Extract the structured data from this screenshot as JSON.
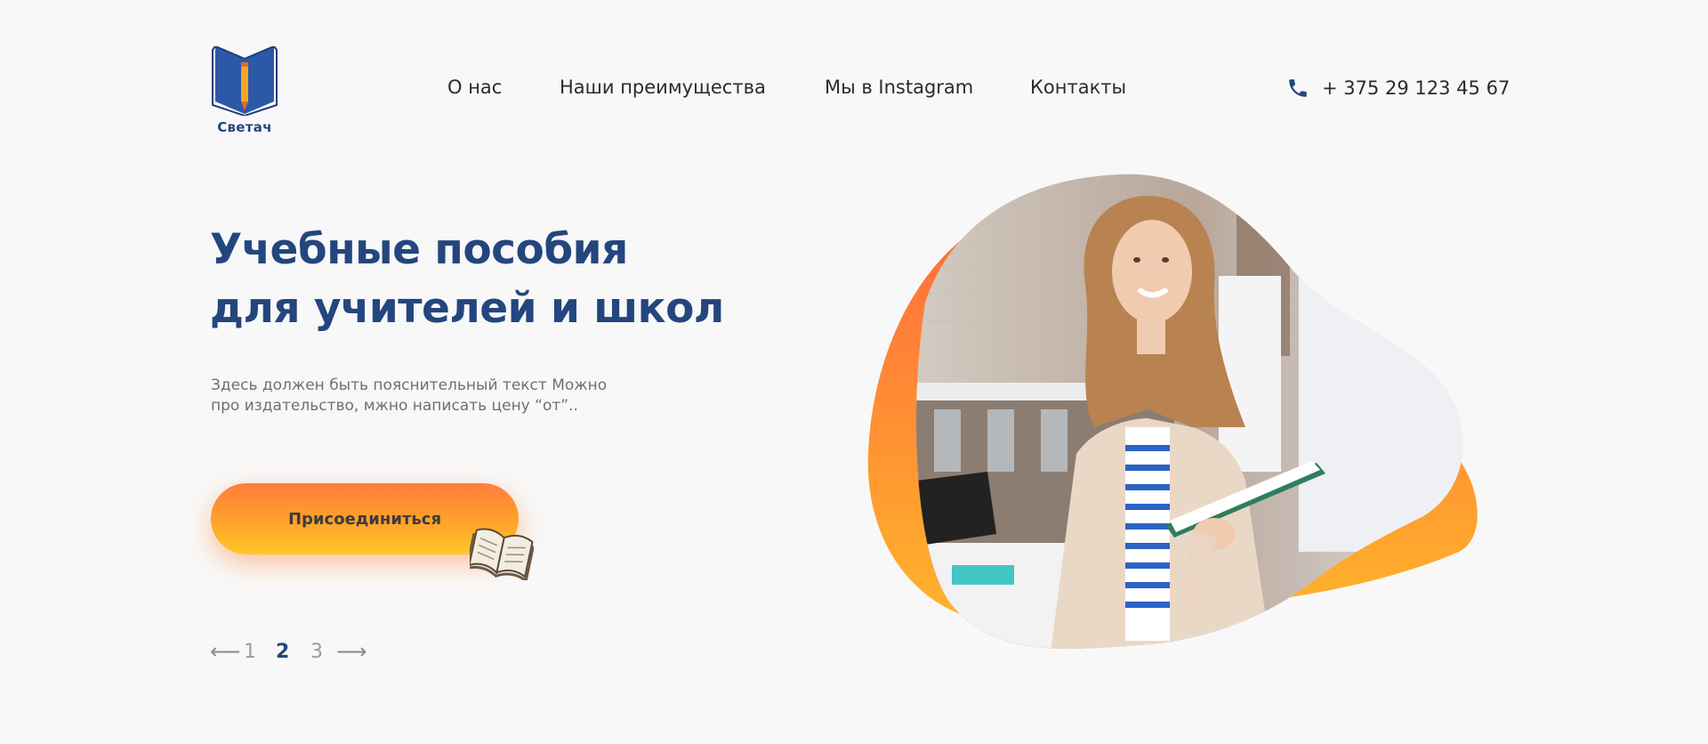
{
  "brand": {
    "name": "Светач",
    "color": "#24467e"
  },
  "nav": {
    "items": [
      {
        "label": "О нас"
      },
      {
        "label": "Наши преимущества"
      },
      {
        "label": "Мы в Instagram"
      },
      {
        "label": "Контакты"
      }
    ]
  },
  "contact": {
    "phone": "+ 375 29 123 45 67",
    "icon": "phone-icon"
  },
  "hero": {
    "title_line1": "Учебные пособия",
    "title_line2": "для учителей и школ",
    "description_line1": "Здесь должен быть пояснительный текст Можно",
    "description_line2": "про издательство, мжно написать цену “от”..",
    "cta_label": "Присоединиться",
    "accent_color": "#ffa32b"
  },
  "pagination": {
    "prev_arrow": "⟵",
    "next_arrow": "⟶",
    "pages": [
      "1",
      "2",
      "3"
    ],
    "current": "2"
  }
}
